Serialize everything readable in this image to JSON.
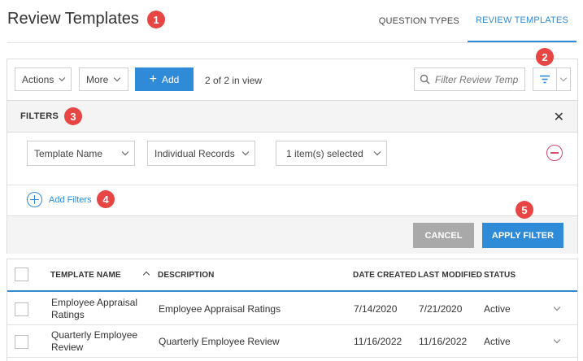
{
  "header": {
    "title": "Review Templates",
    "tabs": [
      {
        "label": "QUESTION TYPES"
      },
      {
        "label": "REVIEW TEMPLATES"
      }
    ]
  },
  "badges": [
    "1",
    "2",
    "3",
    "4",
    "5"
  ],
  "toolbar": {
    "actions_label": "Actions",
    "more_label": "More",
    "add_label": "Add",
    "in_view": "2 of 2 in view",
    "search_placeholder": "Filter Review Temp"
  },
  "filters": {
    "title": "FILTERS",
    "field": "Template Name",
    "operator": "Individual Records",
    "value": "1 item(s) selected",
    "add_label": "Add Filters",
    "cancel_label": "CANCEL",
    "apply_label": "APPLY FILTER"
  },
  "table": {
    "columns": [
      "TEMPLATE NAME",
      "DESCRIPTION",
      "DATE CREATED",
      "LAST MODIFIED",
      "STATUS"
    ],
    "rows": [
      {
        "name": [
          "Employee Appraisal",
          "Ratings"
        ],
        "description": "Employee Appraisal Ratings",
        "created": "7/14/2020",
        "modified": "7/21/2020",
        "status": "Active"
      },
      {
        "name": [
          "Quarterly Employee",
          "Review"
        ],
        "description": "Quarterly Employee Review",
        "created": "11/16/2022",
        "modified": "11/16/2022",
        "status": "Active"
      }
    ]
  },
  "colors": {
    "accent": "#2f8ad8",
    "badge": "#e84545",
    "remove": "#d9456e",
    "cancel": "#a9a9a9"
  }
}
